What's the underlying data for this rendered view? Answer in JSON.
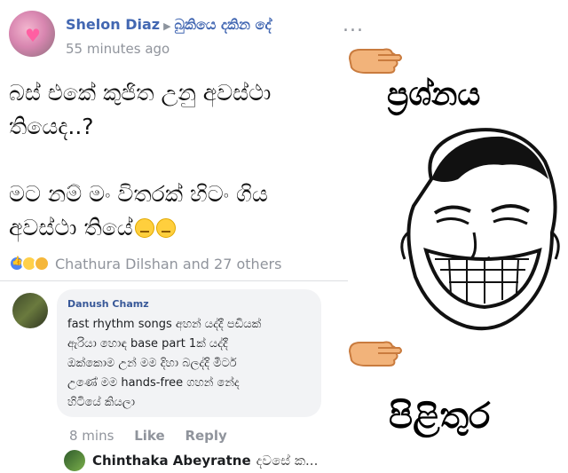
{
  "post": {
    "author": "Shelon Diaz",
    "page": "බුකියෙ දකින දේ",
    "timestamp": "55 minutes ago",
    "more": "...",
    "text_lines_1": [
      "බස් එකේ කුජිත උනු අවස්ථා",
      "තියෙද..?"
    ],
    "text_lines_2": [
      "මට නම් මං විතරක් හිටං ගිය",
      "අවස්ථා තියේ"
    ],
    "reactions_text": "Chathura Dilshan and 27 others"
  },
  "comment": {
    "author": "Danush Chamz",
    "lines": [
      "fast rhythm songs අහන් යද්දී පඩියක්",
      "ඇරියා හොඳ base part 1ක් යද්දී",
      "ඔක්කොම උන් මම දිහා බලද්දි මීටර්",
      "උණේ මම hands-free ගහන් නේද",
      "හිටියේ කියලා"
    ],
    "time": "8 mins",
    "like_label": "Like",
    "reply_label": "Reply"
  },
  "reply_preview": {
    "author": "Chinthaka Abeyratne",
    "text": "දවසේ ක..."
  },
  "meme": {
    "question_label": "ප්‍රශ්නය",
    "answer_label": "පිළිතුර"
  },
  "colors": {
    "name_blue": "#4267b2",
    "muted_gray": "#90949c",
    "bubble_bg": "#f2f3f5"
  },
  "icons": {
    "pointer": "hand-pointing-right-icon",
    "more": "more-options-icon"
  }
}
